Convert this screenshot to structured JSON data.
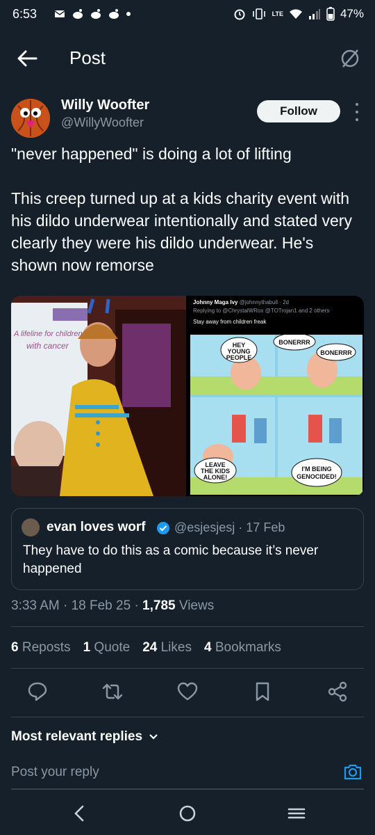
{
  "status": {
    "time": "6:53",
    "battery": "47%",
    "network": "LTE"
  },
  "header": {
    "title": "Post"
  },
  "post": {
    "display_name": "Willy Woofter",
    "handle": "@WillyWoofter",
    "follow_label": "Follow",
    "text": "\"never happened\" is doing a lot of lifting\n\nThis creep turned up at a kids charity event with his dildo underwear intentionally and stated very clearly they were his dildo underwear. He's shown now remorse"
  },
  "media": {
    "left_sign_line1": "A lifeline for children",
    "left_sign_line2": "with cancer",
    "embedded_post": {
      "name": "Johnny Maga Ivy",
      "handle": "@johnnythabull · 2d",
      "replying": "Replying to @ChrystalWRox @TOTrojan1 and 2 others",
      "text": "Stay away from children freak"
    },
    "comic_bubbles": [
      "HEY YOUNG PEOPLE",
      "BONERRR",
      "BONERRR",
      "LEAVE THE KIDS ALONE!",
      "I'M BEING GENOCIDED!"
    ]
  },
  "quote": {
    "name": "evan loves worf",
    "handle_date": "@esjesjesj · 17 Feb",
    "text": "They have to do this as a comic because it’s never happened"
  },
  "meta": {
    "time_date": "3:33 AM · 18 Feb 25 · ",
    "views_count": "1,785",
    "views_label": " Views"
  },
  "stats": {
    "reposts_count": "6",
    "reposts_label": "Reposts",
    "quotes_count": "1",
    "quotes_label": "Quote",
    "likes_count": "24",
    "likes_label": "Likes",
    "bookmarks_count": "4",
    "bookmarks_label": "Bookmarks"
  },
  "replies": {
    "sort_label": "Most relevant replies",
    "placeholder": "Post your reply"
  },
  "colors": {
    "background": "#15202b",
    "accent": "#1d9bf0",
    "muted": "#8b98a5"
  }
}
